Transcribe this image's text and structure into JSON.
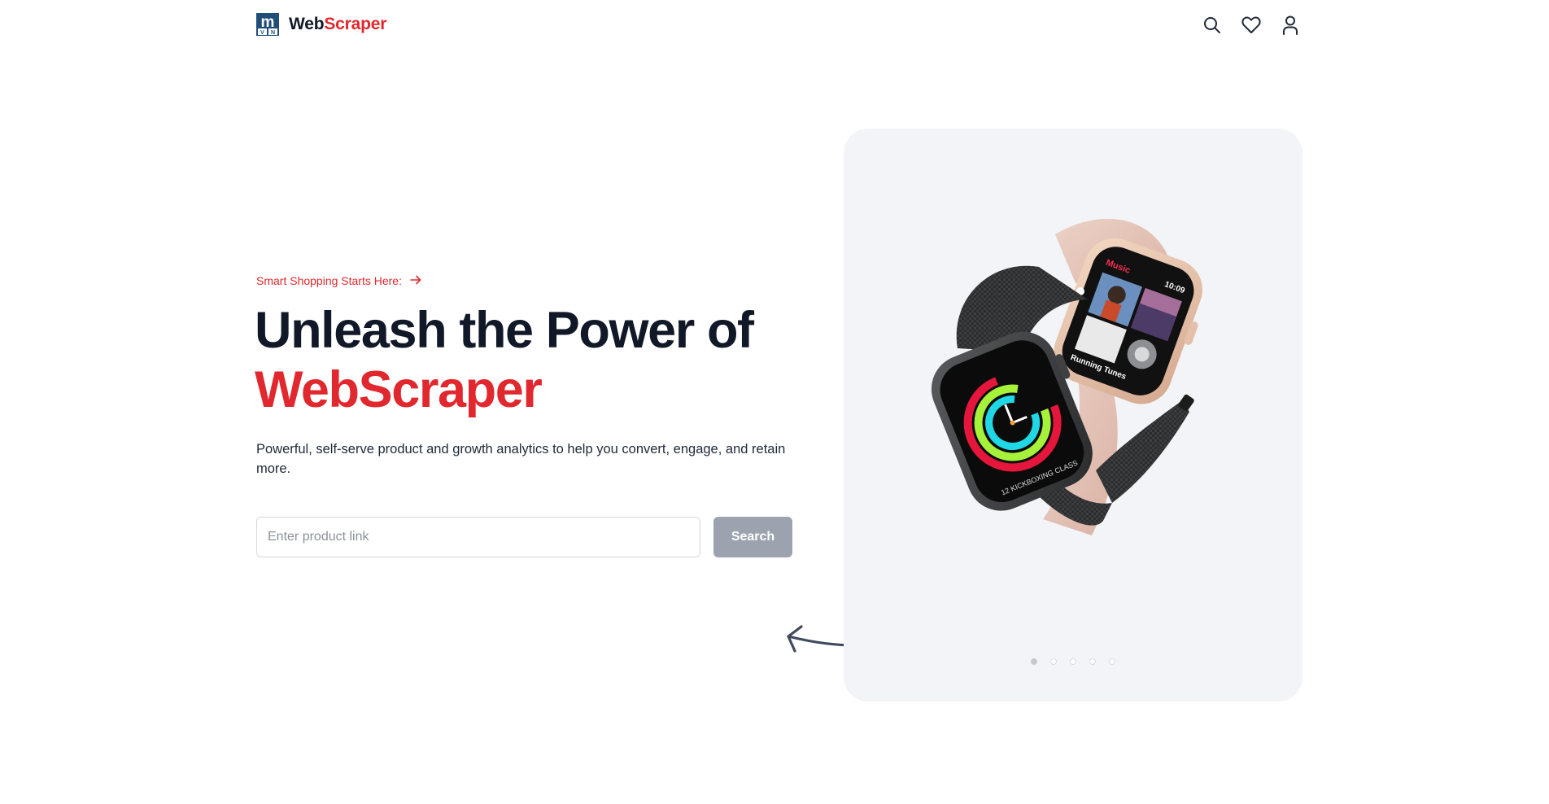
{
  "header": {
    "brand_part1": "Web",
    "brand_part2": "Scraper",
    "logo_letters": {
      "main": "m",
      "sub_left": "V",
      "sub_right": "N"
    },
    "icons": [
      "search-icon",
      "heart-icon",
      "user-icon"
    ]
  },
  "hero": {
    "eyebrow": "Smart Shopping Starts Here:",
    "headline_line1": "Unleash the Power of",
    "headline_line2": "WebScraper",
    "description": "Powerful, self-serve product and growth analytics to help you convert, engage, and retain more.",
    "search_placeholder": "Enter product link",
    "search_value": "",
    "search_button": "Search"
  },
  "carousel": {
    "slide_count": 5,
    "active_index": 0,
    "image": "apple-watch-pair",
    "watch_screen": {
      "app_title": "Music",
      "time": "10:09",
      "track": "Running Tunes",
      "workout": "12 KICKBOXING CLASS"
    }
  },
  "colors": {
    "accent": "#e0282e",
    "text_dark": "#111827",
    "button_disabled": "#9ca3ae",
    "card_bg": "#f3f4f7",
    "logo_blue": "#1f4e79"
  }
}
